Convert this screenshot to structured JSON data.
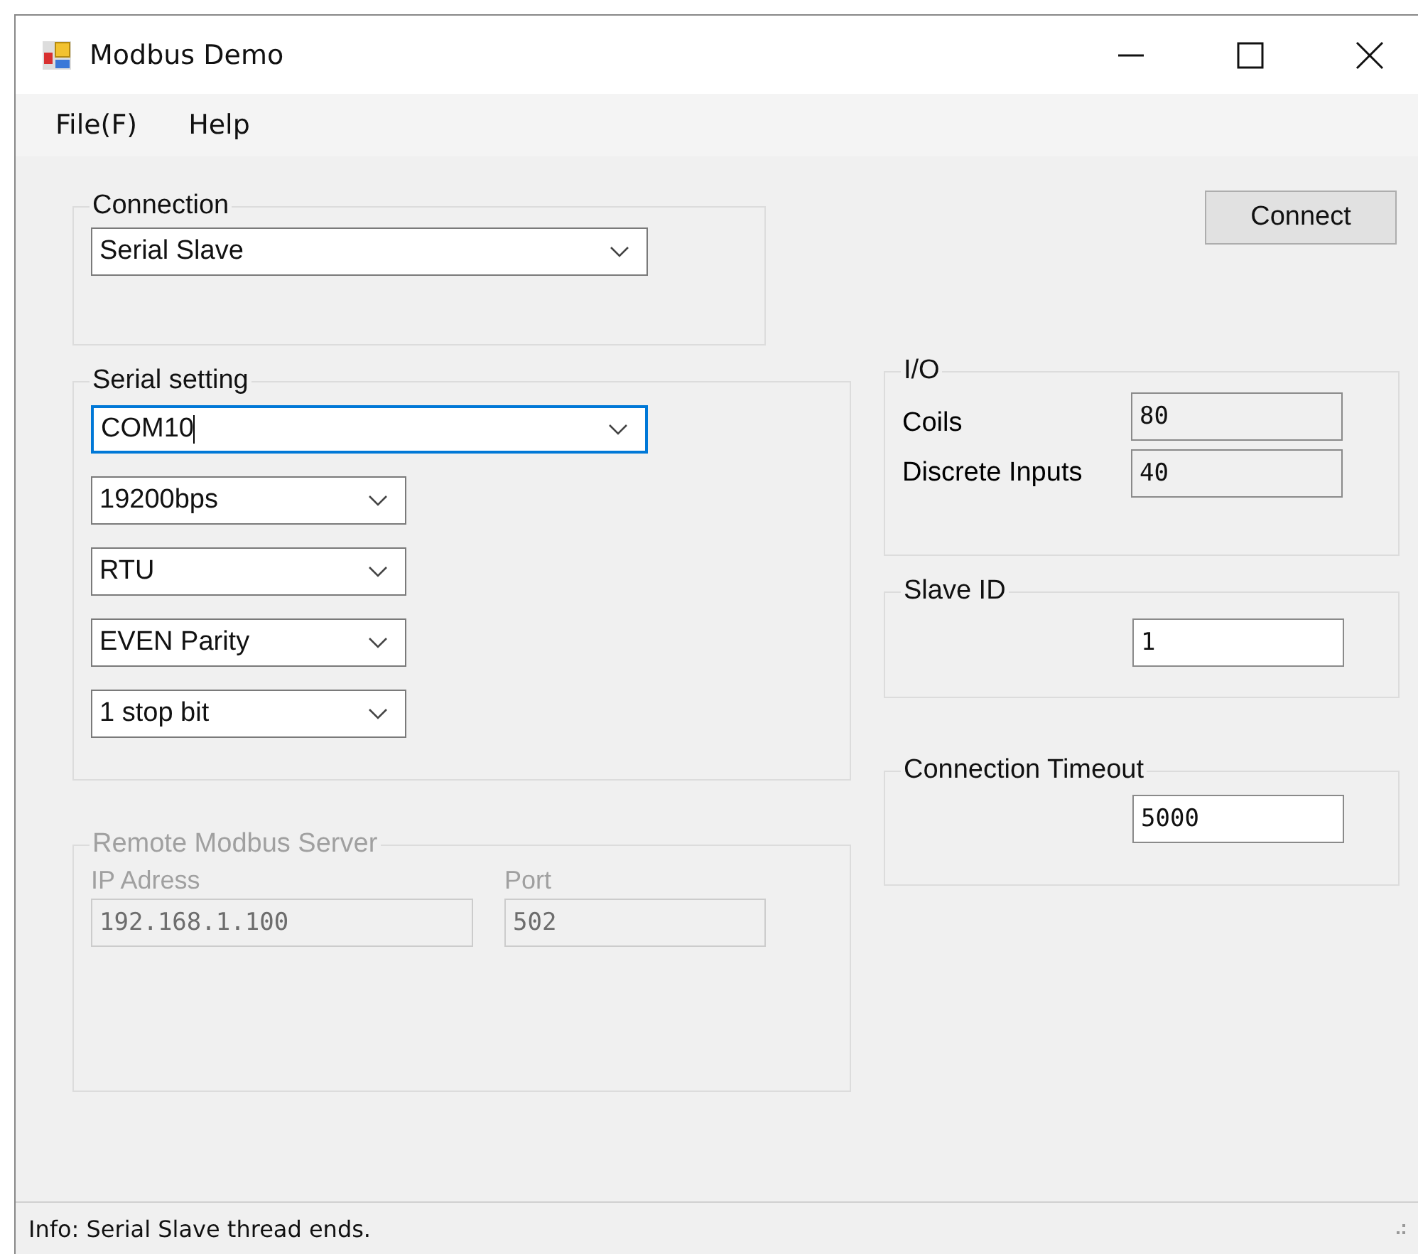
{
  "window": {
    "title": "Modbus Demo"
  },
  "menu": [
    {
      "label": "File(F)"
    },
    {
      "label": "Help"
    }
  ],
  "connection_group": {
    "title": "Connection",
    "combo": {
      "value": "Serial Slave",
      "focused": false
    }
  },
  "serial_group": {
    "title": "Serial setting",
    "combos": [
      {
        "value": "COM10",
        "focused": true
      },
      {
        "value": "19200bps",
        "focused": false
      },
      {
        "value": "RTU",
        "focused": false
      },
      {
        "value": "EVEN Parity",
        "focused": false
      },
      {
        "value": "1 stop bit",
        "focused": false
      }
    ]
  },
  "remote_group": {
    "title": "Remote Modbus Server",
    "disabled": true,
    "fields": [
      {
        "label": "IP Adress",
        "value": "192.168.1.100"
      },
      {
        "label": "Port",
        "value": "502"
      }
    ]
  },
  "connect_button": {
    "label": "Connect"
  },
  "io_group": {
    "title": "I/O",
    "fields": [
      {
        "label": "Coils",
        "value": "80",
        "readonly": true
      },
      {
        "label": "Discrete Inputs",
        "value": "40",
        "readonly": true
      }
    ]
  },
  "slave_id_group": {
    "title": "Slave ID",
    "field": {
      "value": "1",
      "readonly": false
    }
  },
  "timeout_group": {
    "title": "Connection Timeout",
    "field": {
      "value": "5000",
      "readonly": false
    }
  },
  "status_bar": {
    "text": "Info: Serial Slave thread ends."
  }
}
